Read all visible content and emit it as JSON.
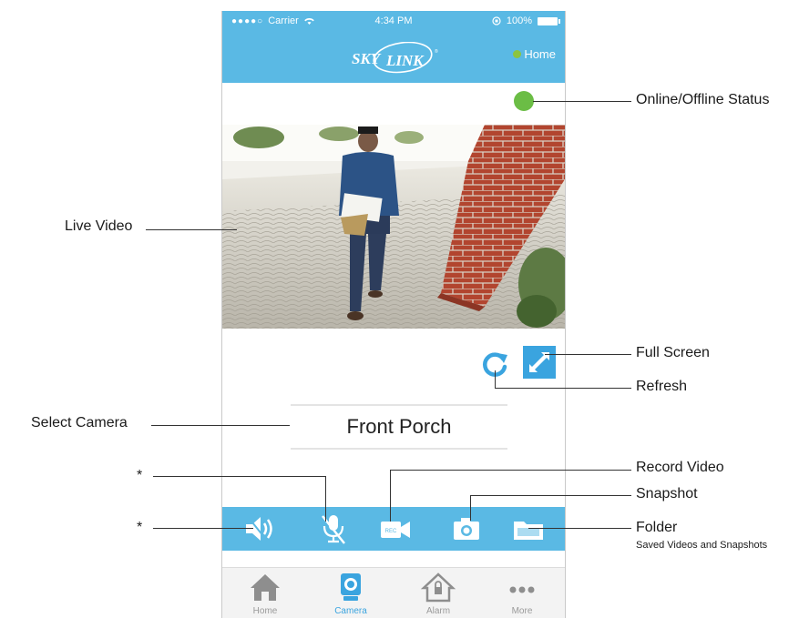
{
  "status_bar": {
    "signal": "●●●●○",
    "carrier": "Carrier",
    "time": "4:34 PM",
    "battery": "100%"
  },
  "header": {
    "logo_text": "SKY LINK",
    "home_label": "Home"
  },
  "camera": {
    "name": "Front Porch",
    "online": true
  },
  "toolbar": {
    "buttons": [
      "speaker-icon",
      "mic-muted-icon",
      "record-video-icon",
      "snapshot-icon",
      "folder-icon"
    ]
  },
  "tabbar": {
    "tabs": [
      {
        "label": "Home",
        "active": false
      },
      {
        "label": "Camera",
        "active": true
      },
      {
        "label": "Alarm",
        "active": false
      },
      {
        "label": "More",
        "active": false
      }
    ]
  },
  "callouts": {
    "status": "Online/Offline Status",
    "live_video": "Live Video",
    "full_screen": "Full Screen",
    "refresh": "Refresh",
    "select_camera": "Select Camera",
    "record_video": "Record Video",
    "snapshot": "Snapshot",
    "folder": "Folder",
    "folder_sub": "Saved Videos and Snapshots",
    "star1": "*",
    "star2": "*"
  },
  "colors": {
    "header": "#5ab9e4",
    "accent": "#3aa4df",
    "online": "#6bbd45"
  }
}
